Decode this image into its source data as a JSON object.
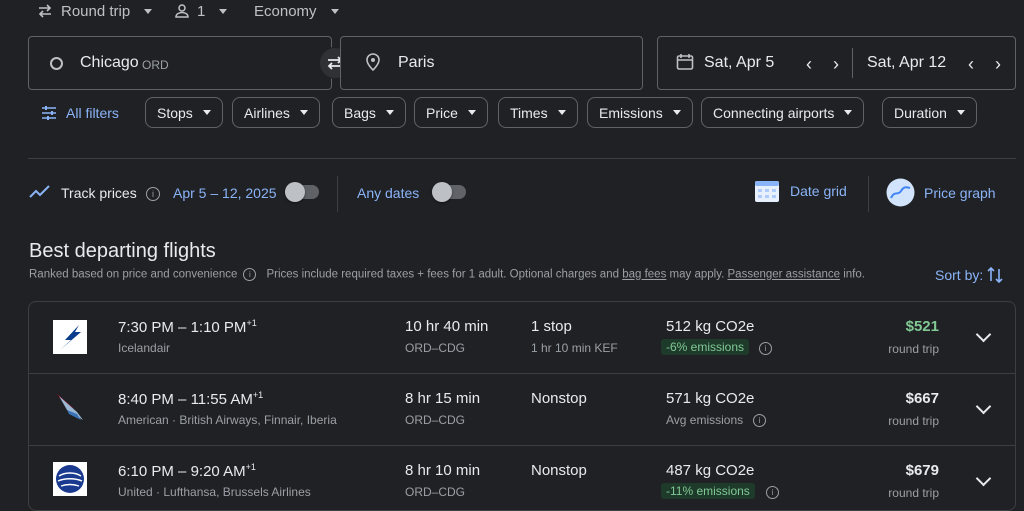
{
  "trip_options": {
    "trip_type": "Round trip",
    "passengers": "1",
    "cabin": "Economy"
  },
  "search": {
    "origin_city": "Chicago",
    "origin_code": "ORD",
    "destination": "Paris",
    "depart_date": "Sat, Apr 5",
    "return_date": "Sat, Apr 12"
  },
  "filters": {
    "all_filters": "All filters",
    "chips": [
      "Stops",
      "Airlines",
      "Bags",
      "Price",
      "Times",
      "Emissions",
      "Connecting airports",
      "Duration"
    ]
  },
  "track": {
    "label": "Track prices",
    "range": "Apr 5 – 12, 2025",
    "any_dates": "Any dates",
    "date_grid": "Date grid",
    "price_graph": "Price graph"
  },
  "results": {
    "heading": "Best departing flights",
    "ranked": "Ranked based on price and convenience",
    "prices_note": "Prices include required taxes + fees for 1 adult. Optional charges and",
    "bag_fees": "bag fees",
    "may_apply": "may apply.",
    "assistance": "Passenger assistance",
    "info": "info.",
    "sort_by": "Sort by:"
  },
  "flights": [
    {
      "dep": "7:30 PM",
      "arr": "1:10 PM",
      "plus": "+1",
      "airlines": "Icelandair",
      "duration": "10 hr 40 min",
      "route": "ORD–CDG",
      "stops": "1 stop",
      "stop_detail": "1 hr 10 min KEF",
      "co2": "512 kg CO2e",
      "emissions": "-6% emissions",
      "price": "$521",
      "price_note": "round trip",
      "price_color": "#81c995"
    },
    {
      "dep": "8:40 PM",
      "arr": "11:55 AM",
      "plus": "+1",
      "airlines": "American · British Airways, Finnair, Iberia",
      "duration": "8 hr 15 min",
      "route": "ORD–CDG",
      "stops": "Nonstop",
      "stop_detail": "",
      "co2": "571 kg CO2e",
      "emissions": "Avg emissions",
      "price": "$667",
      "price_note": "round trip",
      "price_color": "#e8eaed"
    },
    {
      "dep": "6:10 PM",
      "arr": "9:20 AM",
      "plus": "+1",
      "airlines": "United · Lufthansa, Brussels Airlines",
      "duration": "8 hr 10 min",
      "route": "ORD–CDG",
      "stops": "Nonstop",
      "stop_detail": "",
      "co2": "487 kg CO2e",
      "emissions": "-11% emissions",
      "price": "$679",
      "price_note": "round trip",
      "price_color": "#e8eaed"
    }
  ]
}
